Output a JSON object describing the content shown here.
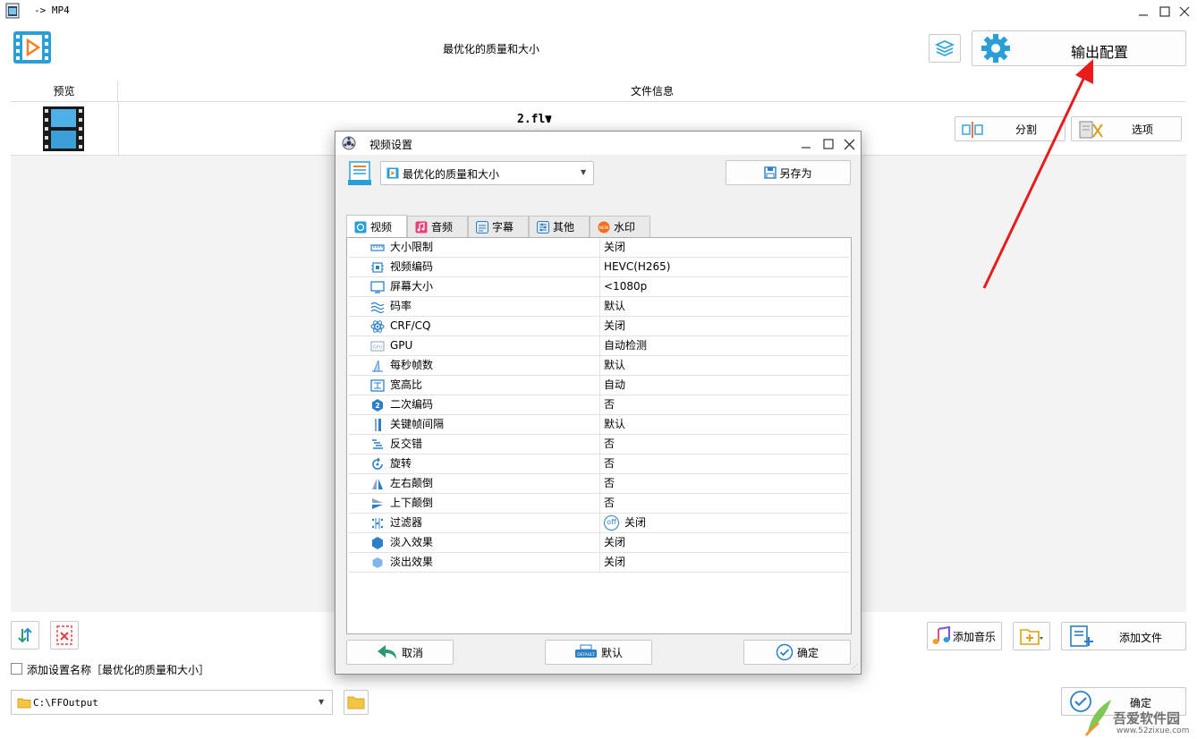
{
  "window": {
    "title": "-> MP4"
  },
  "header": {
    "profile_title": "最优化的质量和大小",
    "output_config_label": "输出配置"
  },
  "file_table": {
    "col_preview": "预览",
    "col_info": "文件信息",
    "file_name": "2.flv",
    "split_label": "分割",
    "options_label": "选项"
  },
  "dialog": {
    "title": "视频设置",
    "profile_select": "最优化的质量和大小",
    "save_as_label": "另存为",
    "tabs": [
      "视频",
      "音频",
      "字幕",
      "其他",
      "水印"
    ],
    "rows": [
      {
        "name": "大小限制",
        "value": "关闭",
        "icon": "ruler-icon"
      },
      {
        "name": "视频编码",
        "value": "HEVC(H265)",
        "icon": "chip-icon"
      },
      {
        "name": "屏幕大小",
        "value": "<1080p",
        "icon": "monitor-icon"
      },
      {
        "name": "码率",
        "value": "默认",
        "icon": "waves-icon"
      },
      {
        "name": "CRF/CQ",
        "value": "关闭",
        "icon": "atom-icon"
      },
      {
        "name": "GPU",
        "value": "自动检测",
        "icon": "gpu-icon"
      },
      {
        "name": "每秒帧数",
        "value": "默认",
        "icon": "frames-icon"
      },
      {
        "name": "宽高比",
        "value": "自动",
        "icon": "aspect-icon"
      },
      {
        "name": "二次编码",
        "value": "否",
        "icon": "two-pass-icon"
      },
      {
        "name": "关键帧间隔",
        "value": "默认",
        "icon": "keyframe-icon"
      },
      {
        "name": "反交错",
        "value": "否",
        "icon": "deinterlace-icon"
      },
      {
        "name": "旋转",
        "value": "否",
        "icon": "rotate-icon"
      },
      {
        "name": "左右颠倒",
        "value": "否",
        "icon": "flip-horizontal-icon"
      },
      {
        "name": "上下颠倒",
        "value": "否",
        "icon": "flip-vertical-icon"
      },
      {
        "name": "过滤器",
        "value": "关闭",
        "icon": "filter-icon"
      },
      {
        "name": "淡入效果",
        "value": "关闭",
        "icon": "fade-in-icon"
      },
      {
        "name": "淡出效果",
        "value": "关闭",
        "icon": "fade-out-icon"
      }
    ],
    "filter_badge": "off",
    "cancel_label": "取消",
    "default_label": "默认",
    "ok_label": "确定"
  },
  "bottom": {
    "add_music_label": "添加音乐",
    "add_file_label": "添加文件",
    "add_setting_name_label": "添加设置名称［最优化的质量和大小］",
    "output_path": "C:\\FFOutput",
    "confirm_label": "确定"
  },
  "watermark": {
    "site_name": "吾爱软件园",
    "site_url": "www.52zixue.com"
  },
  "colors": {
    "accent": "#2a9fd6",
    "annotation_arrow": "#e81c1c"
  }
}
